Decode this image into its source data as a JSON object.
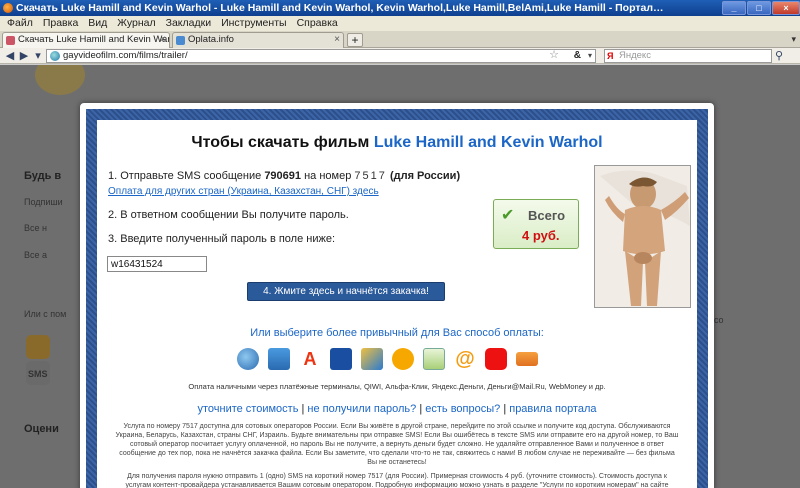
{
  "window": {
    "title": "Скачать Luke Hamill and Kevin Warhol - Luke Hamill and Kevin Warhol, Kevin Warhol,Luke Hamill,BelAmi,Luke Hamill - Портал новинок полнометражных гей порно фильмов - gayvideofil...",
    "controls": [
      "_",
      "□",
      "×"
    ]
  },
  "menu": [
    "Файл",
    "Правка",
    "Вид",
    "Журнал",
    "Закладки",
    "Инструменты",
    "Справка"
  ],
  "tabs": [
    {
      "label": "Скачать Luke Hamill and Kevin Warhol - ...",
      "active": true
    },
    {
      "label": "Oplata.info",
      "active": false
    }
  ],
  "nav": {
    "url": "gayvideofilm.com/films/trailer/",
    "search_placeholder": "Яндекс",
    "search_brand": "Я"
  },
  "modal": {
    "title_prefix": "Чтобы скачать фильм ",
    "film_title": "Luke Hamill and Kevin Warhol",
    "step1_prefix": "1. Отправьте SMS сообщение ",
    "step1_code": "790691",
    "step1_mid": " на номер ",
    "step1_number": "7517",
    "step1_region": "(для России)",
    "other_countries_link": "Оплата для других стран (Украина, Казахстан, СНГ) здесь",
    "step2": "2. В ответном сообщении Вы получите пароль.",
    "step3": "3. Введите полученный пароль в поле ниже:",
    "password_value": "w16431524",
    "download_button": "4. Жмите здесь и начнётся закачка!",
    "price_label": "Всего",
    "price_amount": "4 руб.",
    "alt_payment_title": "Или выберите более привычный для Вас способ оплаты:",
    "payment_icons": [
      "globe-icon",
      "phone-icon",
      "alfa-icon",
      "mail-russia-icon",
      "card-icon",
      "qiwi-icon",
      "envelope-icon",
      "at-icon",
      "mts-icon",
      "ticket-icon"
    ],
    "payment_caption": "Оплата наличными через платёжные терминалы, QIWI, Альфа-Клик, Яндекс.Деньги, Деньги@Mail.Ru, WebMoney и др.",
    "links": [
      "уточните стоимость",
      "не получили пароль?",
      "есть вопросы?",
      "правила портала"
    ],
    "fine1": "Услуга по номеру 7517 доступна для сотовых операторов России. Если Вы живёте в другой стране, перейдите по этой ссылке и получите код доступа. Обслуживаются Украина, Беларусь, Казахстан, страны СНГ, Израиль. Будьте внимательны при отправке SMS! Если Вы ошибётесь в тексте SMS или отправите его на другой номер, то Ваш сотовый оператор посчитает услугу оплаченной, но пароль Вы не получите, а вернуть деньги будет сложно. Не удаляйте отправленное Вами и полученное в ответ сообщение до тех пор, пока не начнётся закачка файла. Если Вы заметите, что сделали что-то не так, свяжитесь с нами! В любом случае не переживайте — без фильма Вы не останетесь!",
    "fine2": "Для получения пароля нужно отправить 1 (одно) SMS на короткий номер 7517 (для России). Примерная стоимость 4 руб. (уточните стоимость). Стоимость доступа к услугам контент-провайдера устанавливается Вашим сотовым оператором. Подробную информацию можно узнать в разделе \"Услуги по коротким номерам\" на сайте"
  },
  "background": {
    "sidebar_heading1": "Будь в",
    "sidebar_heading2": "Оцени",
    "sidebar_small": [
      "Подпиши",
      "Все н",
      "Все а",
      "Или с пом"
    ],
    "sms_label": "SMS",
    "right_snippet": "ico"
  },
  "colors": {
    "accent": "#1b66c6",
    "button": "#2b5a9a",
    "price": "#d01010",
    "frame": "#2d4f8a"
  }
}
